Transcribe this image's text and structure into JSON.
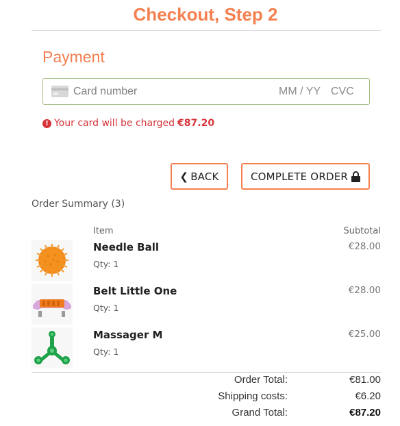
{
  "header": {
    "title": "Checkout, Step 2"
  },
  "payment": {
    "section_title": "Payment",
    "card_placeholder": "Card number",
    "expiry_placeholder": "MM / YY",
    "cvc_placeholder": "CVC",
    "charge_prefix": "Your card will be charged",
    "charge_amount": "€87.20"
  },
  "actions": {
    "back_label": "BACK",
    "complete_label": "COMPLETE ORDER"
  },
  "summary": {
    "title": "Order Summary (3)",
    "col_item": "Item",
    "col_subtotal": "Subtotal",
    "items": [
      {
        "name": "Needle Ball",
        "qty": "Qty: 1",
        "price": "€28.00",
        "image": "orange-spiky-ball"
      },
      {
        "name": "Belt Little One",
        "qty": "Qty: 1",
        "price": "€28.00",
        "image": "orange-massage-belt"
      },
      {
        "name": "Massager M",
        "qty": "Qty: 1",
        "price": "€25.00",
        "image": "green-spinner-massager"
      }
    ],
    "totals": {
      "order_label": "Order Total:",
      "order_value": "€81.00",
      "shipping_label": "Shipping costs:",
      "shipping_value": "€6.20",
      "grand_label": "Grand Total:",
      "grand_value": "€87.20"
    }
  },
  "colors": {
    "accent": "#f47f4f",
    "error": "#d6343a",
    "input_border": "#a7bb84"
  }
}
